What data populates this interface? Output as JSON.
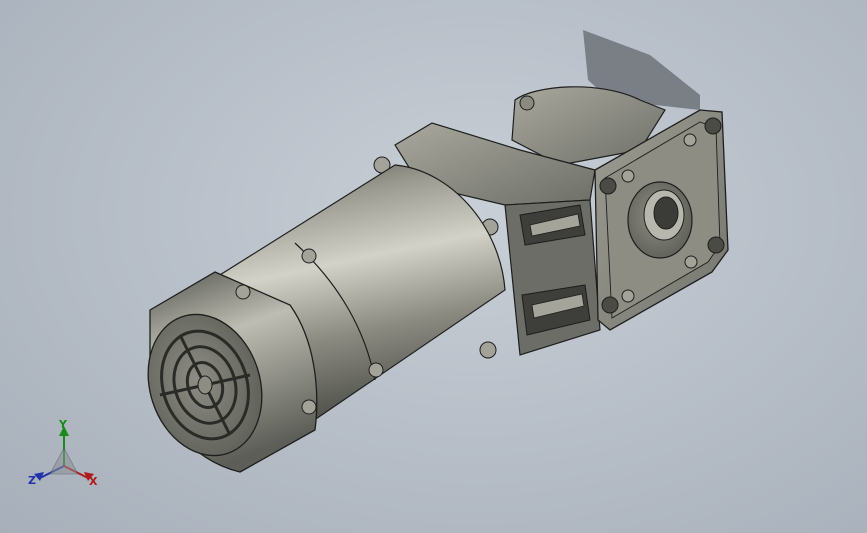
{
  "viewport": {
    "background": "#b9c0c9",
    "model": {
      "shell_color": "#7d7d73",
      "shadow_color": "#6f737a",
      "edge_color": "#1e1e1e"
    },
    "triad": {
      "x_label": "X",
      "y_label": "Y",
      "z_label": "Z",
      "x_color": "#b01a1a",
      "y_color": "#1a8a1a",
      "z_color": "#2233aa"
    }
  }
}
